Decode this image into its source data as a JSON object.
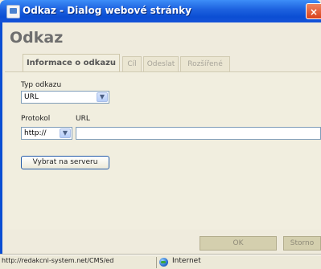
{
  "window": {
    "title": "Odkaz - Dialog webové stránky",
    "close_glyph": "×"
  },
  "dialog": {
    "heading": "Odkaz"
  },
  "tabs": [
    {
      "label": "Informace o odkazu",
      "active": true
    },
    {
      "label": "Cíl",
      "active": false
    },
    {
      "label": "Odeslat",
      "active": false
    },
    {
      "label": "Rozšířené",
      "active": false
    }
  ],
  "form": {
    "link_type_label": "Typ odkazu",
    "link_type_value": "URL",
    "protocol_label": "Protokol",
    "protocol_value": "http://",
    "url_label": "URL",
    "url_value": "",
    "browse_button": "Vybrat na serveru"
  },
  "buttons": {
    "ok": "OK",
    "cancel": "Storno"
  },
  "statusbar": {
    "url": "http://redakcni-system.net/CMS/ed",
    "zone": "Internet"
  },
  "icons": {
    "title": "dialog-window-icon",
    "zone": "globe-icon"
  },
  "colors": {
    "titlebar": "#0b4ed3",
    "dialog_bg": "#efebdd",
    "close": "#d9421c"
  }
}
